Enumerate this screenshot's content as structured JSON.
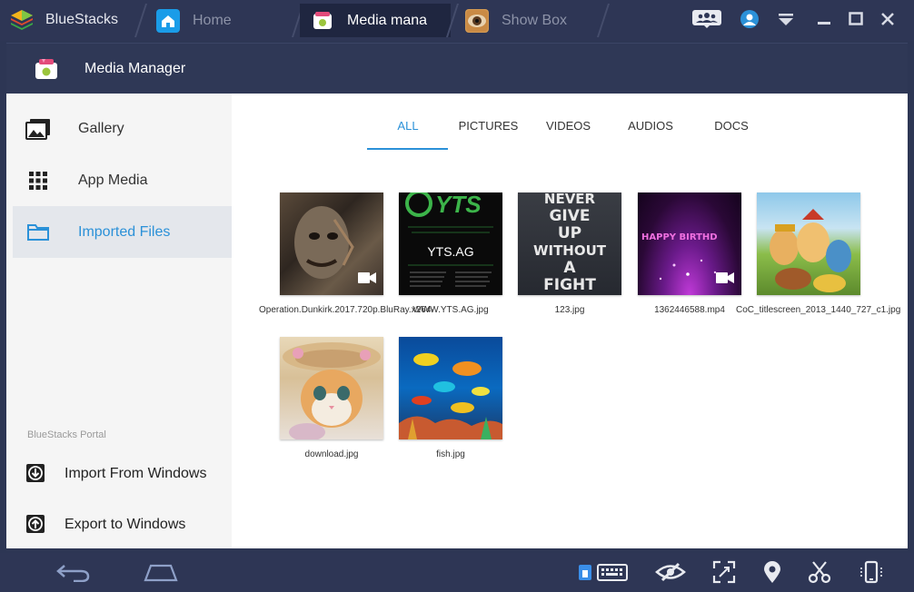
{
  "window": {
    "brand": "BlueStacks",
    "tabs": [
      {
        "label": "Home",
        "icon": "home-icon"
      },
      {
        "label": "Media mana",
        "icon": "media-manager-icon"
      },
      {
        "label": "Show Box",
        "icon": "show-box-icon"
      }
    ],
    "controls": [
      "community-icon",
      "account-icon",
      "dropdown-icon",
      "minimize-icon",
      "maximize-icon",
      "close-icon"
    ]
  },
  "app": {
    "title": "Media Manager"
  },
  "sidebar": {
    "items": [
      {
        "label": "Gallery",
        "icon": "gallery-icon"
      },
      {
        "label": "App Media",
        "icon": "grid-icon"
      },
      {
        "label": "Imported Files",
        "icon": "folder-icon"
      }
    ],
    "selected": "Imported Files",
    "portal_label": "BlueStacks Portal",
    "actions": [
      {
        "label": "Import From Windows",
        "icon": "import-icon"
      },
      {
        "label": "Export to Windows",
        "icon": "export-icon"
      }
    ]
  },
  "content": {
    "tabs": [
      "ALL",
      "PICTURES",
      "VIDEOS",
      "AUDIOS",
      "DOCS"
    ],
    "active_tab": "ALL",
    "files": [
      {
        "caption": "Operation.Dunkirk.2017.720p.BluRay.x264-",
        "type": "video"
      },
      {
        "caption": "WWW.YTS.AG.jpg",
        "type": "image",
        "image_text_top": "YTS",
        "image_text_mid": "YTS.AG"
      },
      {
        "caption": "123.jpg",
        "type": "image",
        "image_text": [
          "NEVER",
          "GIVE",
          "UP",
          "WITHOUT",
          "A",
          "FIGHT"
        ]
      },
      {
        "caption": "1362446588.mp4",
        "type": "video",
        "image_text": "HAPPY BIRTHD"
      },
      {
        "caption": "CoC_titlescreen_2013_1440_727_c1.jpg",
        "type": "image"
      },
      {
        "caption": "download.jpg",
        "type": "image"
      },
      {
        "caption": "fish.jpg",
        "type": "image"
      }
    ]
  },
  "navbar": {
    "left": [
      "back-icon",
      "home-icon"
    ],
    "right": [
      "keyboard-icon",
      "eye-icon",
      "fullscreen-icon",
      "location-icon",
      "scissors-icon",
      "rotate-phone-icon"
    ]
  },
  "colors": {
    "chrome": "#2e3655",
    "accent": "#2b91d8",
    "sidebar_bg": "#f5f5f5"
  }
}
